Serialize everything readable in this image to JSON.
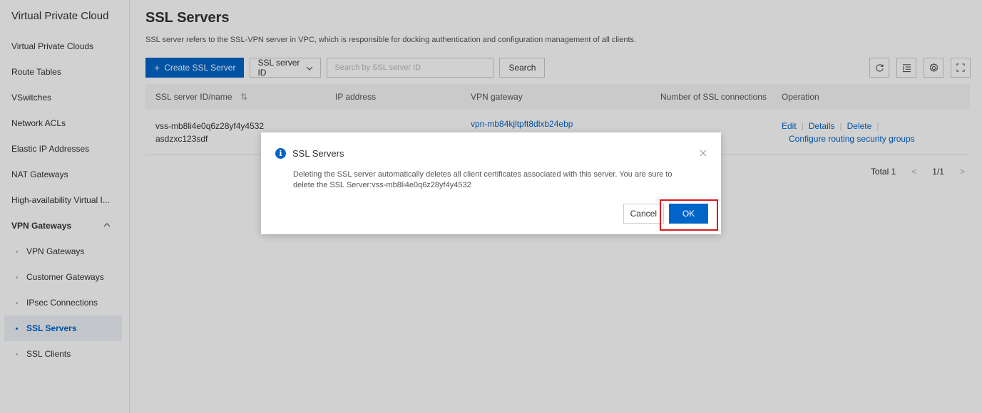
{
  "sidebar": {
    "title": "Virtual Private Cloud",
    "items": [
      {
        "label": "Virtual Private Clouds"
      },
      {
        "label": "Route Tables"
      },
      {
        "label": "VSwitches"
      },
      {
        "label": "Network ACLs"
      },
      {
        "label": "Elastic IP Addresses"
      },
      {
        "label": "NAT Gateways"
      },
      {
        "label": "High-availability Virtual I..."
      }
    ],
    "group": {
      "label": "VPN Gateways",
      "chevron_icon": "chevron-up-icon",
      "children": [
        {
          "label": "VPN Gateways"
        },
        {
          "label": "Customer Gateways"
        },
        {
          "label": "IPsec Connections"
        },
        {
          "label": "SSL Servers",
          "active": true
        },
        {
          "label": "SSL Clients"
        }
      ]
    }
  },
  "header": {
    "title": "SSL Servers",
    "description": "SSL server refers to the SSL-VPN server in VPC, which is responsible for docking authentication and configuration management of all clients."
  },
  "toolbar": {
    "create_label": "Create SSL Server",
    "filter_select": "SSL server ID",
    "search_placeholder": "Search by SSL server ID",
    "search_label": "Search",
    "icons": [
      "refresh-icon",
      "list-settings-icon",
      "gear-icon",
      "fullscreen-icon"
    ]
  },
  "table": {
    "columns": {
      "name": "SSL server ID/name",
      "ip": "IP address",
      "vpn": "VPN gateway",
      "connections": "Number of SSL connections",
      "operation": "Operation"
    },
    "rows": [
      {
        "id": "vss-mb8li4e0q6z28yf4y4532",
        "name": "asdzxc123sdf",
        "ip": "",
        "vpn": "vpn-mb84kjltpft8dlxb24ebp",
        "connections": "",
        "ops": {
          "edit": "Edit",
          "details": "Details",
          "delete": "Delete",
          "routing": "Configure routing security groups"
        }
      }
    ]
  },
  "pagination": {
    "total": "Total 1",
    "page": "1/1"
  },
  "modal": {
    "title": "SSL Servers",
    "body": "Deleting the SSL server automatically deletes all client certificates associated with this server. You are sure to delete the SSL Server:vss-mb8li4e0q6z28yf4y4532",
    "cancel_label": "Cancel",
    "ok_label": "OK"
  },
  "colors": {
    "primary": "#0064c8",
    "highlight": "#e0161b"
  }
}
